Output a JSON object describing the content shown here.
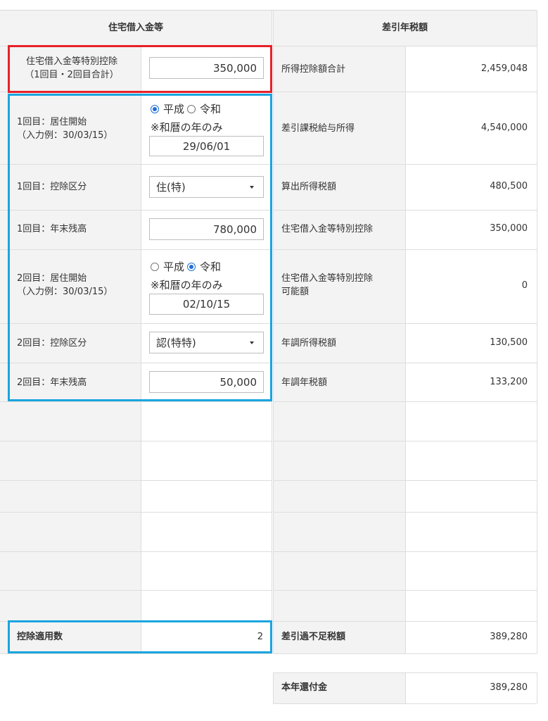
{
  "header": {
    "left_title": "住宅借入金等",
    "right_title": "差引年税額"
  },
  "left": {
    "special_deduction": {
      "label_line1": "住宅借入金等特別控除",
      "label_line2": "（1回目・2回目合計）",
      "value": "350,000"
    },
    "first_start": {
      "label_line1": "1回目：居住開始",
      "label_line2": "（入力例：30/03/15）",
      "era_options": [
        "平成",
        "令和"
      ],
      "era_selected": "平成",
      "note": "※和暦の年のみ",
      "value": "29/06/01"
    },
    "first_category": {
      "label": "1回目：控除区分",
      "value": "住(特)"
    },
    "first_balance": {
      "label": "1回目：年末残高",
      "value": "780,000"
    },
    "second_start": {
      "label_line1": "2回目：居住開始",
      "label_line2": "（入力例：30/03/15）",
      "era_options": [
        "平成",
        "令和"
      ],
      "era_selected": "令和",
      "note": "※和暦の年のみ",
      "value": "02/10/15"
    },
    "second_category": {
      "label": "2回目：控除区分",
      "value": "認(特特)"
    },
    "second_balance": {
      "label": "2回目：年末残高",
      "value": "50,000"
    },
    "apply_count": {
      "label": "控除適用数",
      "value": "2"
    }
  },
  "right": {
    "rows": [
      {
        "label": "所得控除額合計",
        "value": "2,459,048"
      },
      {
        "label": "差引課税給与所得",
        "value": "4,540,000"
      },
      {
        "label": "算出所得税額",
        "value": "480,500"
      },
      {
        "label": "住宅借入金等特別控除",
        "value": "350,000"
      },
      {
        "label_line1": "住宅借入金等特別控除",
        "label_line2": "可能額",
        "value": "0"
      },
      {
        "label": "年調所得税額",
        "value": "130,500"
      },
      {
        "label": "年調年税額",
        "value": "133,200"
      }
    ],
    "shortage": {
      "label": "差引過不足税額",
      "value": "389,280"
    },
    "refund": {
      "label": "本年還付金",
      "value": "389,280"
    }
  },
  "colors": {
    "red_highlight": "#e8202a",
    "blue_highlight": "#1aa5e0",
    "radio_checked": "#1f6fd6"
  }
}
